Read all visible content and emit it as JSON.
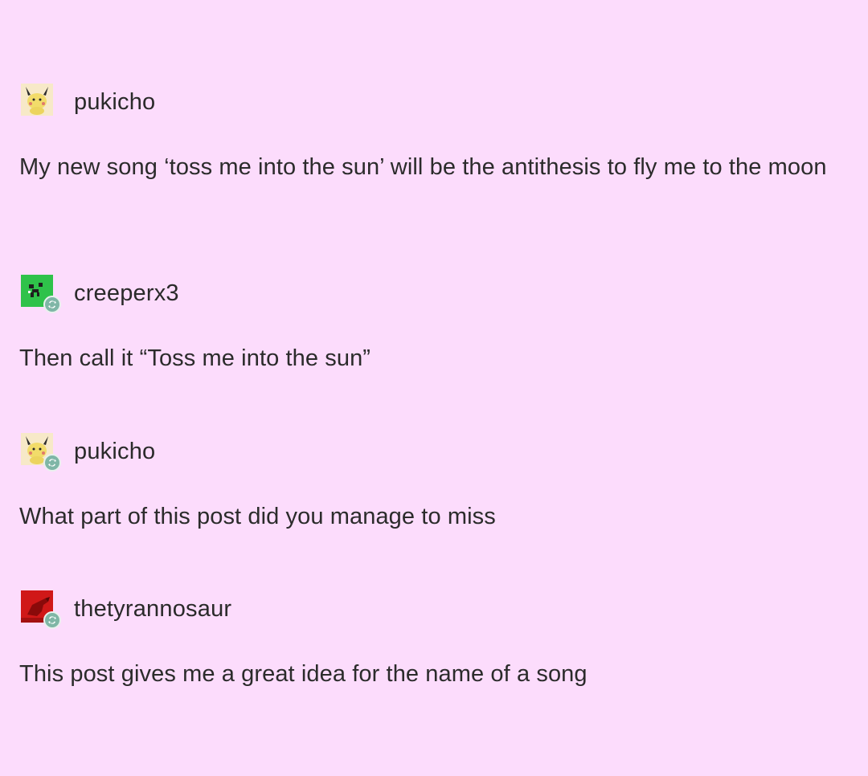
{
  "posts": [
    {
      "username": "pukicho",
      "avatar_icon": "pikachu-avatar-icon",
      "reblogged": false,
      "text": "My new song ‘toss me into the sun’ will be the antithesis to fly me to the moon"
    },
    {
      "username": "creeperx3",
      "avatar_icon": "creeper-avatar-icon",
      "reblogged": true,
      "text": "Then call it “Toss me into the sun”"
    },
    {
      "username": "pukicho",
      "avatar_icon": "pikachu-avatar-icon",
      "reblogged": true,
      "text": "What part of this post did you manage to miss"
    },
    {
      "username": "thetyrannosaur",
      "avatar_icon": "red-dinosaur-avatar-icon",
      "reblogged": true,
      "text": "This post gives me a great idea for the name of a song"
    }
  ],
  "colors": {
    "background": "#fcdcfc",
    "text": "#2b2b2b",
    "reblog_badge": "#7fb6a6",
    "creeper_green": "#2fc24a",
    "dino_red": "#d01818",
    "pikachu_yellow": "#f2dc6a"
  }
}
